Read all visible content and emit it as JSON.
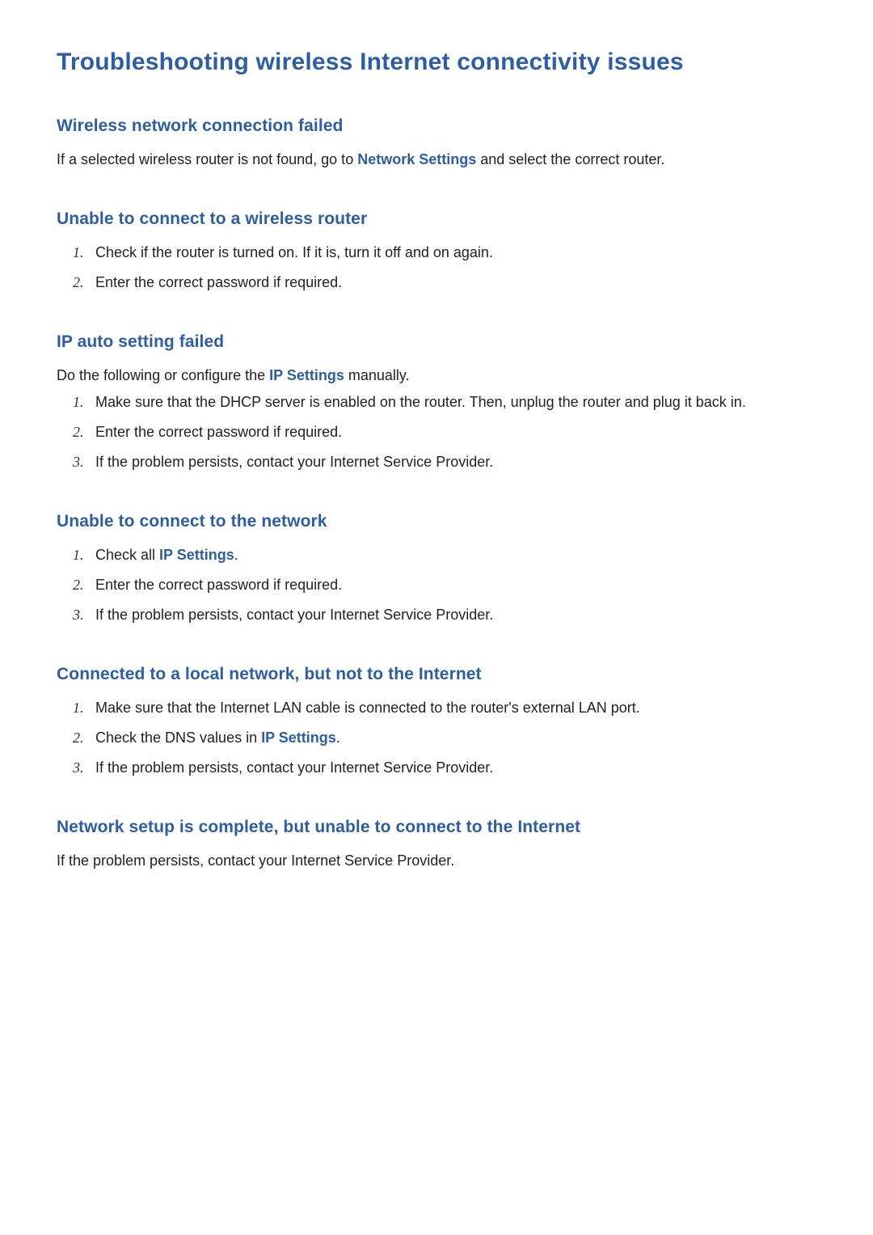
{
  "title": "Troubleshooting wireless Internet connectivity issues",
  "links": {
    "network_settings": "Network Settings",
    "ip_settings": "IP Settings"
  },
  "sections": {
    "s1": {
      "heading": "Wireless network connection failed",
      "intro_before": "If a selected wireless router is not found, go to ",
      "intro_after": " and select the correct router."
    },
    "s2": {
      "heading": "Unable to connect to a wireless router",
      "items": {
        "i1": "Check if the router is turned on. If it is, turn it off and on again.",
        "i2": "Enter the correct password if required."
      }
    },
    "s3": {
      "heading": "IP auto setting failed",
      "intro_before": "Do the following or configure the ",
      "intro_after": " manually.",
      "items": {
        "i1": "Make sure that the DHCP server is enabled on the router. Then, unplug the router and plug it back in.",
        "i2": "Enter the correct password if required.",
        "i3": "If the problem persists, contact your Internet Service Provider."
      }
    },
    "s4": {
      "heading": "Unable to connect to the network",
      "items": {
        "i1_before": "Check all ",
        "i1_after": ".",
        "i2": "Enter the correct password if required.",
        "i3": "If the problem persists, contact your Internet Service Provider."
      }
    },
    "s5": {
      "heading": "Connected to a local network, but not to the Internet",
      "items": {
        "i1": "Make sure that the Internet LAN cable is connected to the router's external LAN port.",
        "i2_before": "Check the DNS values in ",
        "i2_after": ".",
        "i3": "If the problem persists, contact your Internet Service Provider."
      }
    },
    "s6": {
      "heading": "Network setup is complete, but unable to connect to the Internet",
      "intro": "If the problem persists, contact your Internet Service Provider."
    }
  },
  "numbers": {
    "n1": "1.",
    "n2": "2.",
    "n3": "3."
  }
}
